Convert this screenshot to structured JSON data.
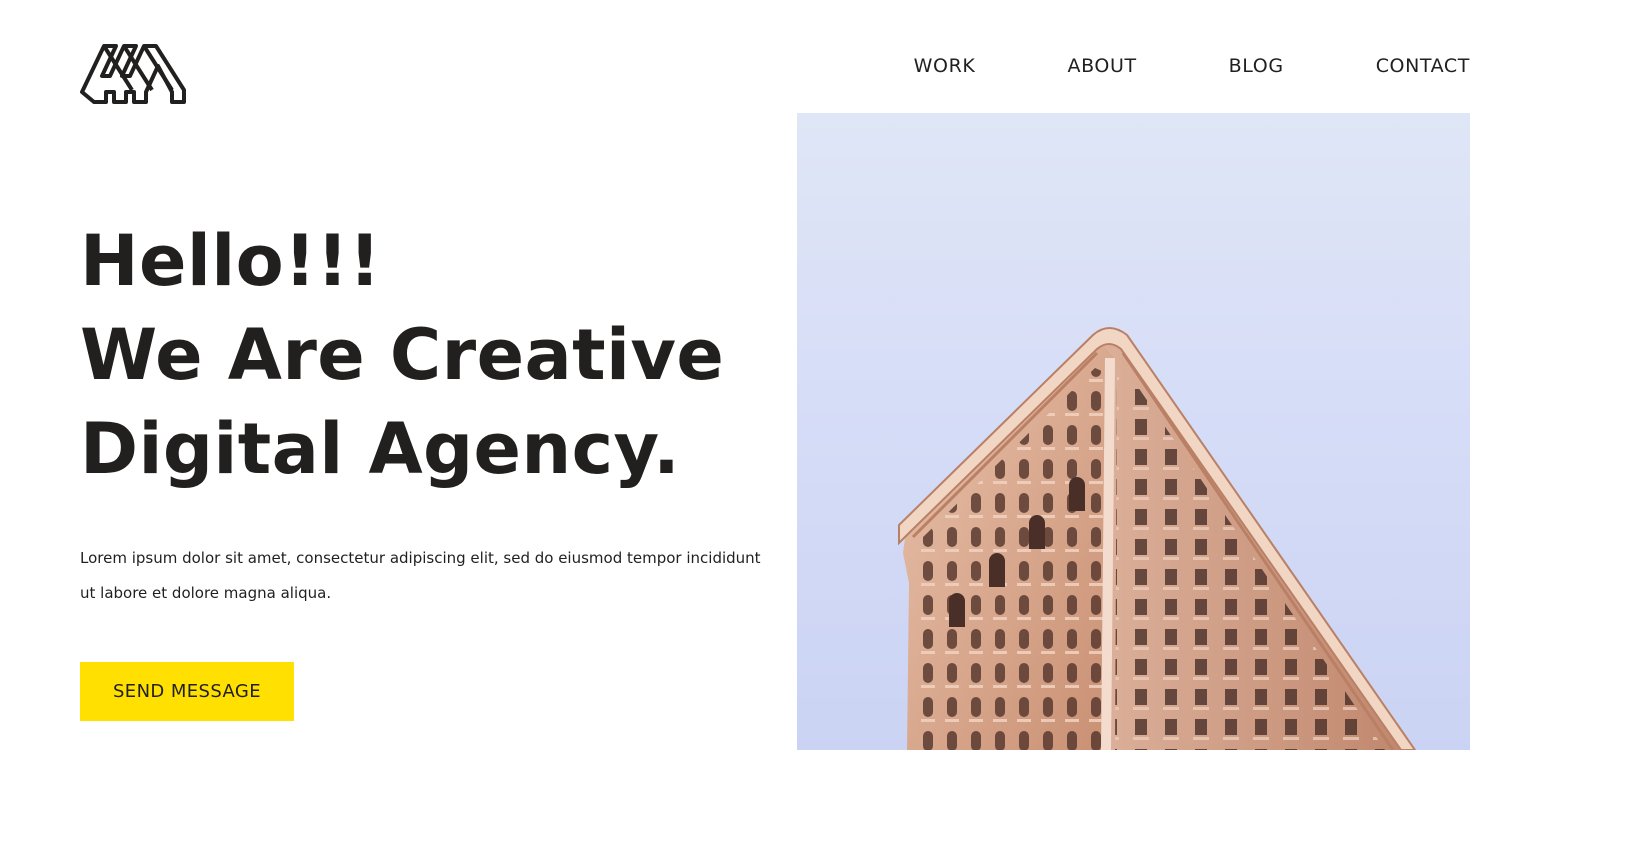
{
  "nav": {
    "items": [
      {
        "label": "WORK"
      },
      {
        "label": "ABOUT"
      },
      {
        "label": "BLOG"
      },
      {
        "label": "CONTACT"
      }
    ]
  },
  "hero": {
    "title_lines": [
      "Hello!!!",
      "We Are Creative",
      "Digital Agency."
    ],
    "description": "Lorem ipsum dolor sit amet, consectetur adipiscing elit, sed do eiusmod tempor incididunt ut labore et dolore magna aliqua.",
    "cta_label": "SEND MESSAGE"
  },
  "colors": {
    "accent": "#ffe000",
    "text": "#221f1f",
    "sky": "#d6ddf7",
    "building": "#d9a98f"
  },
  "icons": {
    "logo": "triple-m-outline-logo-icon"
  }
}
